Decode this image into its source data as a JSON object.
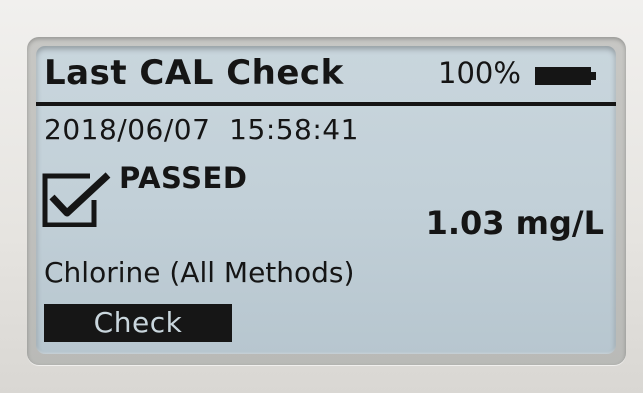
{
  "screen": {
    "title": "Last CAL Check",
    "battery_percent": "100%",
    "battery_icon": "battery-icon",
    "battery_level": 1.0,
    "datetime": "2018/06/07  15:58:41",
    "status_icon": "checkbox-checked-icon",
    "status": "PASSED",
    "reading": "1.03 mg/L",
    "method": "Chlorine (All Methods)"
  },
  "softkeys": {
    "left_label": "Check"
  },
  "colors": {
    "lcd_background": "#c4d2da",
    "lcd_ink": "#151515",
    "device_body": "#e7e5e1"
  }
}
